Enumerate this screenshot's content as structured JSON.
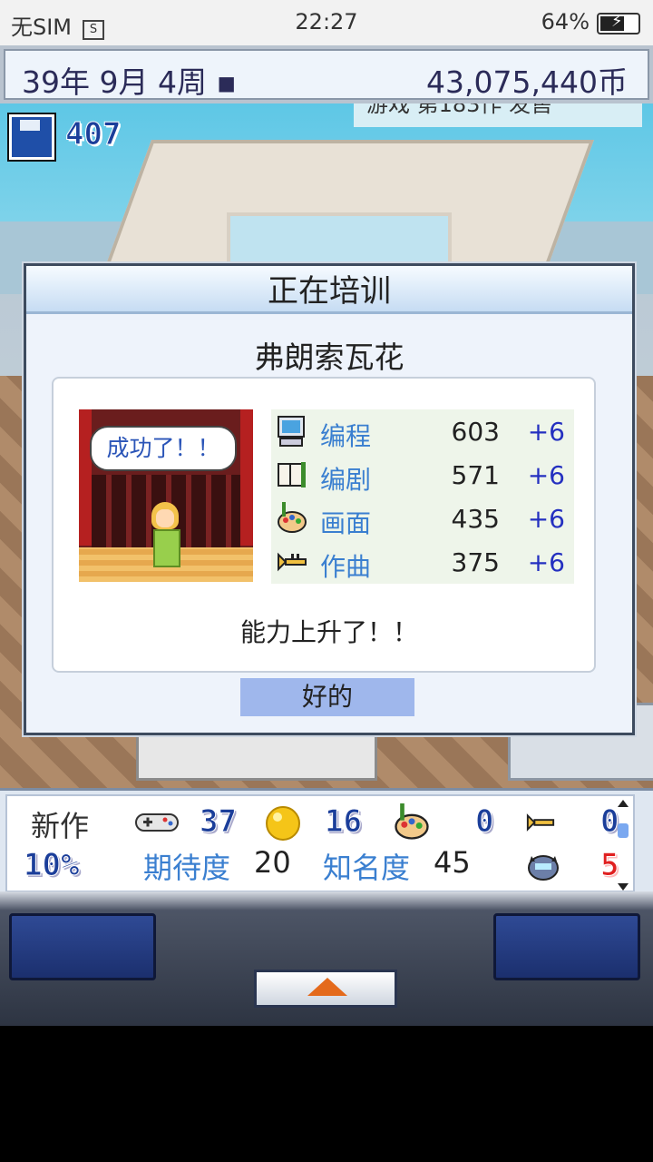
{
  "status_bar": {
    "carrier": "无SIM",
    "sim_icon": "S",
    "time": "22:27",
    "battery": "64%"
  },
  "top_bar": {
    "date": "39年 9月 4周 ▪",
    "money": "43,075,440币"
  },
  "scene": {
    "save_count": "407",
    "ticker": "游戏 第183作 发售"
  },
  "dialog": {
    "title": "正在培训",
    "name": "弗朗索瓦花",
    "bubble": "成功了！！",
    "stats": [
      {
        "icon": "computer-icon",
        "label": "编程",
        "value": "603",
        "delta": "+6"
      },
      {
        "icon": "script-book-icon",
        "label": "编剧",
        "value": "571",
        "delta": "+6"
      },
      {
        "icon": "paint-palette-icon",
        "label": "画面",
        "value": "435",
        "delta": "+6"
      },
      {
        "icon": "trumpet-icon",
        "label": "作曲",
        "value": "375",
        "delta": "+6"
      }
    ],
    "message": "能力上升了！！",
    "ok": "好的"
  },
  "info_panel": {
    "new_work": "新作",
    "progress": "10%",
    "fun": "37",
    "creativity": "16",
    "graphics": "0",
    "music": "0",
    "bugs": "5",
    "expect_label": "期待度",
    "expect_value": "20",
    "fame_label": "知名度",
    "fame_value": "45"
  },
  "colors": {
    "accent_blue": "#1b3e9a",
    "stat_label": "#3a7fd0",
    "delta": "#2430c0",
    "ok_button": "#9fb7ec"
  }
}
